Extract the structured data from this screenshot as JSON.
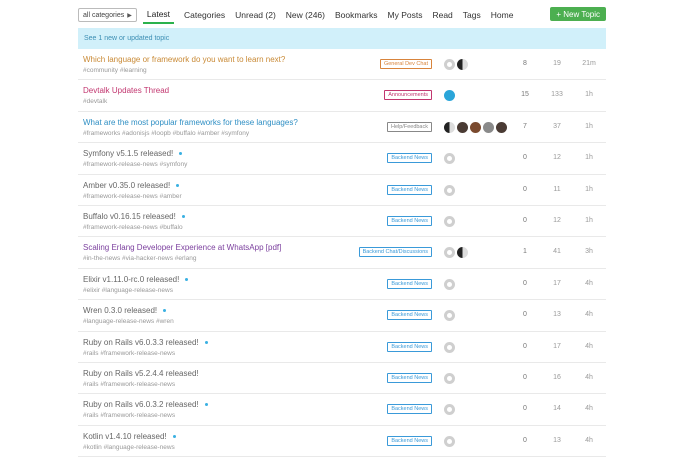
{
  "nav": {
    "category_dropdown": "all categories",
    "tabs": [
      "Latest",
      "Categories",
      "Unread (2)",
      "New (246)",
      "Bookmarks",
      "My Posts",
      "Read",
      "Tags",
      "Home"
    ],
    "new_topic_label": "+ New Topic"
  },
  "banner": {
    "text": "See 1 new or updated topic"
  },
  "colors": {
    "accent": "#2bb24c",
    "new_topic": "#4caf50",
    "banner_bg": "#d1f0fa",
    "unread_dot": "#3ab0e2"
  },
  "topics": [
    {
      "title": "Which language or framework do you want to learn next?",
      "title_color": "#c98a36",
      "unread_dot": false,
      "tags": "#community #learning",
      "category": "General Dev Chat",
      "category_color": "#d8843c",
      "posters": [
        "av-logo",
        "av-bw"
      ],
      "replies": "8",
      "views": "19",
      "activity": "21m"
    },
    {
      "title": "Devtalk Updates Thread",
      "title_color": "#c2366f",
      "unread_dot": false,
      "tags": "#devtalk",
      "category": "Announcements",
      "category_color": "#c2366f",
      "posters": [
        "av-blue"
      ],
      "replies": "15",
      "views": "133",
      "activity": "1h"
    },
    {
      "title": "What are the most popular frameworks for these languages?",
      "title_color": "#2f8fc4",
      "unread_dot": false,
      "tags": "#frameworks #adonisjs #loopb #buffalo #amber #symfony",
      "category": "Help/Feedback",
      "category_color": "#888888",
      "posters": [
        "av-bw",
        "av-dark",
        "av-brown",
        "av-gray",
        "av-dark"
      ],
      "replies": "7",
      "views": "37",
      "activity": "1h"
    },
    {
      "title": "Symfony v5.1.5 released!",
      "title_color": "#666666",
      "unread_dot": true,
      "tags": "#framework-release-news #symfony",
      "category": "Backend News",
      "category_color": "#3a9ad9",
      "posters": [
        "av-logo"
      ],
      "replies": "0",
      "views": "12",
      "activity": "1h"
    },
    {
      "title": "Amber v0.35.0 released!",
      "title_color": "#666666",
      "unread_dot": true,
      "tags": "#framework-release-news #amber",
      "category": "Backend News",
      "category_color": "#3a9ad9",
      "posters": [
        "av-logo"
      ],
      "replies": "0",
      "views": "11",
      "activity": "1h"
    },
    {
      "title": "Buffalo v0.16.15 released!",
      "title_color": "#666666",
      "unread_dot": true,
      "tags": "#framework-release-news #buffalo",
      "category": "Backend News",
      "category_color": "#3a9ad9",
      "posters": [
        "av-logo"
      ],
      "replies": "0",
      "views": "12",
      "activity": "1h"
    },
    {
      "title": "Scaling Erlang Developer Experience at WhatsApp [pdf]",
      "title_color": "#7b3f9e",
      "unread_dot": false,
      "tags": "#in-the-news #via-hacker-news #erlang",
      "category": "Backend Chat/Discussions",
      "category_color": "#3a9ad9",
      "posters": [
        "av-logo",
        "av-bw"
      ],
      "replies": "1",
      "views": "41",
      "activity": "3h"
    },
    {
      "title": "Elixir v1.11.0-rc.0 released!",
      "title_color": "#666666",
      "unread_dot": true,
      "tags": "#elixir #language-release-news",
      "category": "Backend News",
      "category_color": "#3a9ad9",
      "posters": [
        "av-logo"
      ],
      "replies": "0",
      "views": "17",
      "activity": "4h"
    },
    {
      "title": "Wren 0.3.0 released!",
      "title_color": "#666666",
      "unread_dot": true,
      "tags": "#language-release-news #wren",
      "category": "Backend News",
      "category_color": "#3a9ad9",
      "posters": [
        "av-logo"
      ],
      "replies": "0",
      "views": "13",
      "activity": "4h"
    },
    {
      "title": "Ruby on Rails v6.0.3.3 released!",
      "title_color": "#666666",
      "unread_dot": true,
      "tags": "#rails #framework-release-news",
      "category": "Backend News",
      "category_color": "#3a9ad9",
      "posters": [
        "av-logo"
      ],
      "replies": "0",
      "views": "17",
      "activity": "4h"
    },
    {
      "title": "Ruby on Rails v5.2.4.4 released!",
      "title_color": "#666666",
      "unread_dot": false,
      "tags": "#rails #framework-release-news",
      "category": "Backend News",
      "category_color": "#3a9ad9",
      "posters": [
        "av-logo"
      ],
      "replies": "0",
      "views": "16",
      "activity": "4h"
    },
    {
      "title": "Ruby on Rails v6.0.3.2 released!",
      "title_color": "#666666",
      "unread_dot": true,
      "tags": "#rails #framework-release-news",
      "category": "Backend News",
      "category_color": "#3a9ad9",
      "posters": [
        "av-logo"
      ],
      "replies": "0",
      "views": "14",
      "activity": "4h"
    },
    {
      "title": "Kotlin v1.4.10 released!",
      "title_color": "#666666",
      "unread_dot": true,
      "tags": "#kotlin #language-release-news",
      "category": "Backend News",
      "category_color": "#3a9ad9",
      "posters": [
        "av-logo"
      ],
      "replies": "0",
      "views": "13",
      "activity": "4h"
    }
  ]
}
